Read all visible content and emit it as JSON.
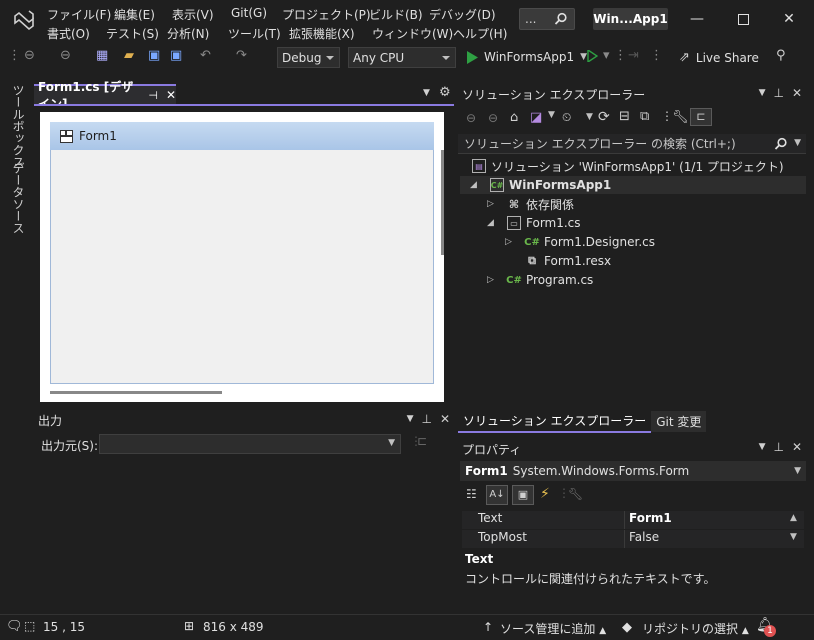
{
  "menu": {
    "row1": [
      "ファイル(F)",
      "編集(E)",
      "表示(V)",
      "Git(G)",
      "プロジェクト(P)",
      "ビルド(B)",
      "デバッグ(D)"
    ],
    "row2": [
      "書式(O)",
      "テスト(S)",
      "分析(N)",
      "ツール(T)",
      "拡張機能(X)",
      "ウィンドウ(W)",
      "ヘルプ(H)"
    ]
  },
  "title": {
    "search_placeholder": "...",
    "badge": "Win...App1"
  },
  "toolbar": {
    "config": "Debug",
    "platform": "Any CPU",
    "start_target": "WinFormsApp1",
    "live_share": "Live Share"
  },
  "left_tabs": [
    "ツールボックス",
    "データソース"
  ],
  "designer": {
    "tab_label": "Form1.cs [デザイン]",
    "form_title": "Form1"
  },
  "output": {
    "title": "出力",
    "source_label": "出力元(S):"
  },
  "solution_explorer": {
    "title": "ソリューション エクスプローラー",
    "search_placeholder": "ソリューション エクスプローラー の検索 (Ctrl+;)",
    "tree": [
      {
        "label": "ソリューション 'WinFormsApp1' (1/1 プロジェクト)"
      },
      {
        "label": "WinFormsApp1"
      },
      {
        "label": "依存関係"
      },
      {
        "label": "Form1.cs"
      },
      {
        "label": "Form1.Designer.cs"
      },
      {
        "label": "Form1.resx"
      },
      {
        "label": "Program.cs"
      }
    ],
    "tabs": [
      "ソリューション エクスプローラー",
      "Git 変更"
    ]
  },
  "properties": {
    "title": "プロパティ",
    "object_name": "Form1",
    "object_type": "System.Windows.Forms.Form",
    "rows": [
      {
        "name": "Text",
        "value": "Form1"
      },
      {
        "name": "TopMost",
        "value": "False"
      }
    ],
    "desc_title": "Text",
    "desc_text": "コントロールに関連付けられたテキストです。"
  },
  "statusbar": {
    "position": "15 , 15",
    "size": "816 x 489",
    "source_control": "ソース管理に追加",
    "repository": "リポジトリの選択",
    "notifications": "1"
  },
  "colors": {
    "accent": "#8a7ae0",
    "csharp_green": "#6ab84b",
    "run_green": "#2ea043",
    "notification_red": "#e05252"
  }
}
